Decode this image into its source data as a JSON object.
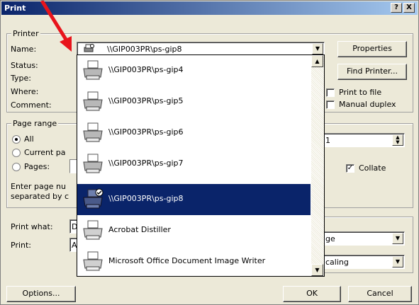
{
  "window": {
    "title": "Print",
    "help": "?",
    "close": "X"
  },
  "printer": {
    "group_label": "Printer",
    "name_label": "Name:",
    "name_value": "\\\\GIP003PR\\ps-gip8",
    "status_label": "Status:",
    "type_label": "Type:",
    "where_label": "Where:",
    "comment_label": "Comment:",
    "properties": "Properties",
    "find_printer": "Find Printer...",
    "print_to_file": "Print to file",
    "manual_duplex": "Manual duplex"
  },
  "page_range": {
    "group_label": "Page range",
    "all": "All",
    "current": "Current pa",
    "pages": "Pages:",
    "hint1": "Enter page nu",
    "hint2": "separated by c"
  },
  "copies": {
    "count": "1",
    "collate": "Collate",
    "collate_checked": true
  },
  "print_what": {
    "label": "Print what:",
    "value": "D"
  },
  "print": {
    "label": "Print:",
    "value": "A"
  },
  "zoom": {
    "pages_value": "ge",
    "scale_value": "caling"
  },
  "dropdown": {
    "items": [
      {
        "name": "\\\\GIP003PR\\ps-gip4",
        "selected": false
      },
      {
        "name": "\\\\GIP003PR\\ps-gip5",
        "selected": false
      },
      {
        "name": "\\\\GIP003PR\\ps-gip6",
        "selected": false
      },
      {
        "name": "\\\\GIP003PR\\ps-gip7",
        "selected": false
      },
      {
        "name": "\\\\GIP003PR\\ps-gip8",
        "selected": true
      },
      {
        "name": "Acrobat Distiller",
        "selected": false
      },
      {
        "name": "Microsoft Office Document Image Writer",
        "selected": false
      }
    ]
  },
  "buttons": {
    "options": "Options...",
    "ok": "OK",
    "cancel": "Cancel"
  },
  "colors": {
    "selection": "#0a246a",
    "annotation_arrow": "#e8141c",
    "dialog_bg": "#ece9d8"
  }
}
